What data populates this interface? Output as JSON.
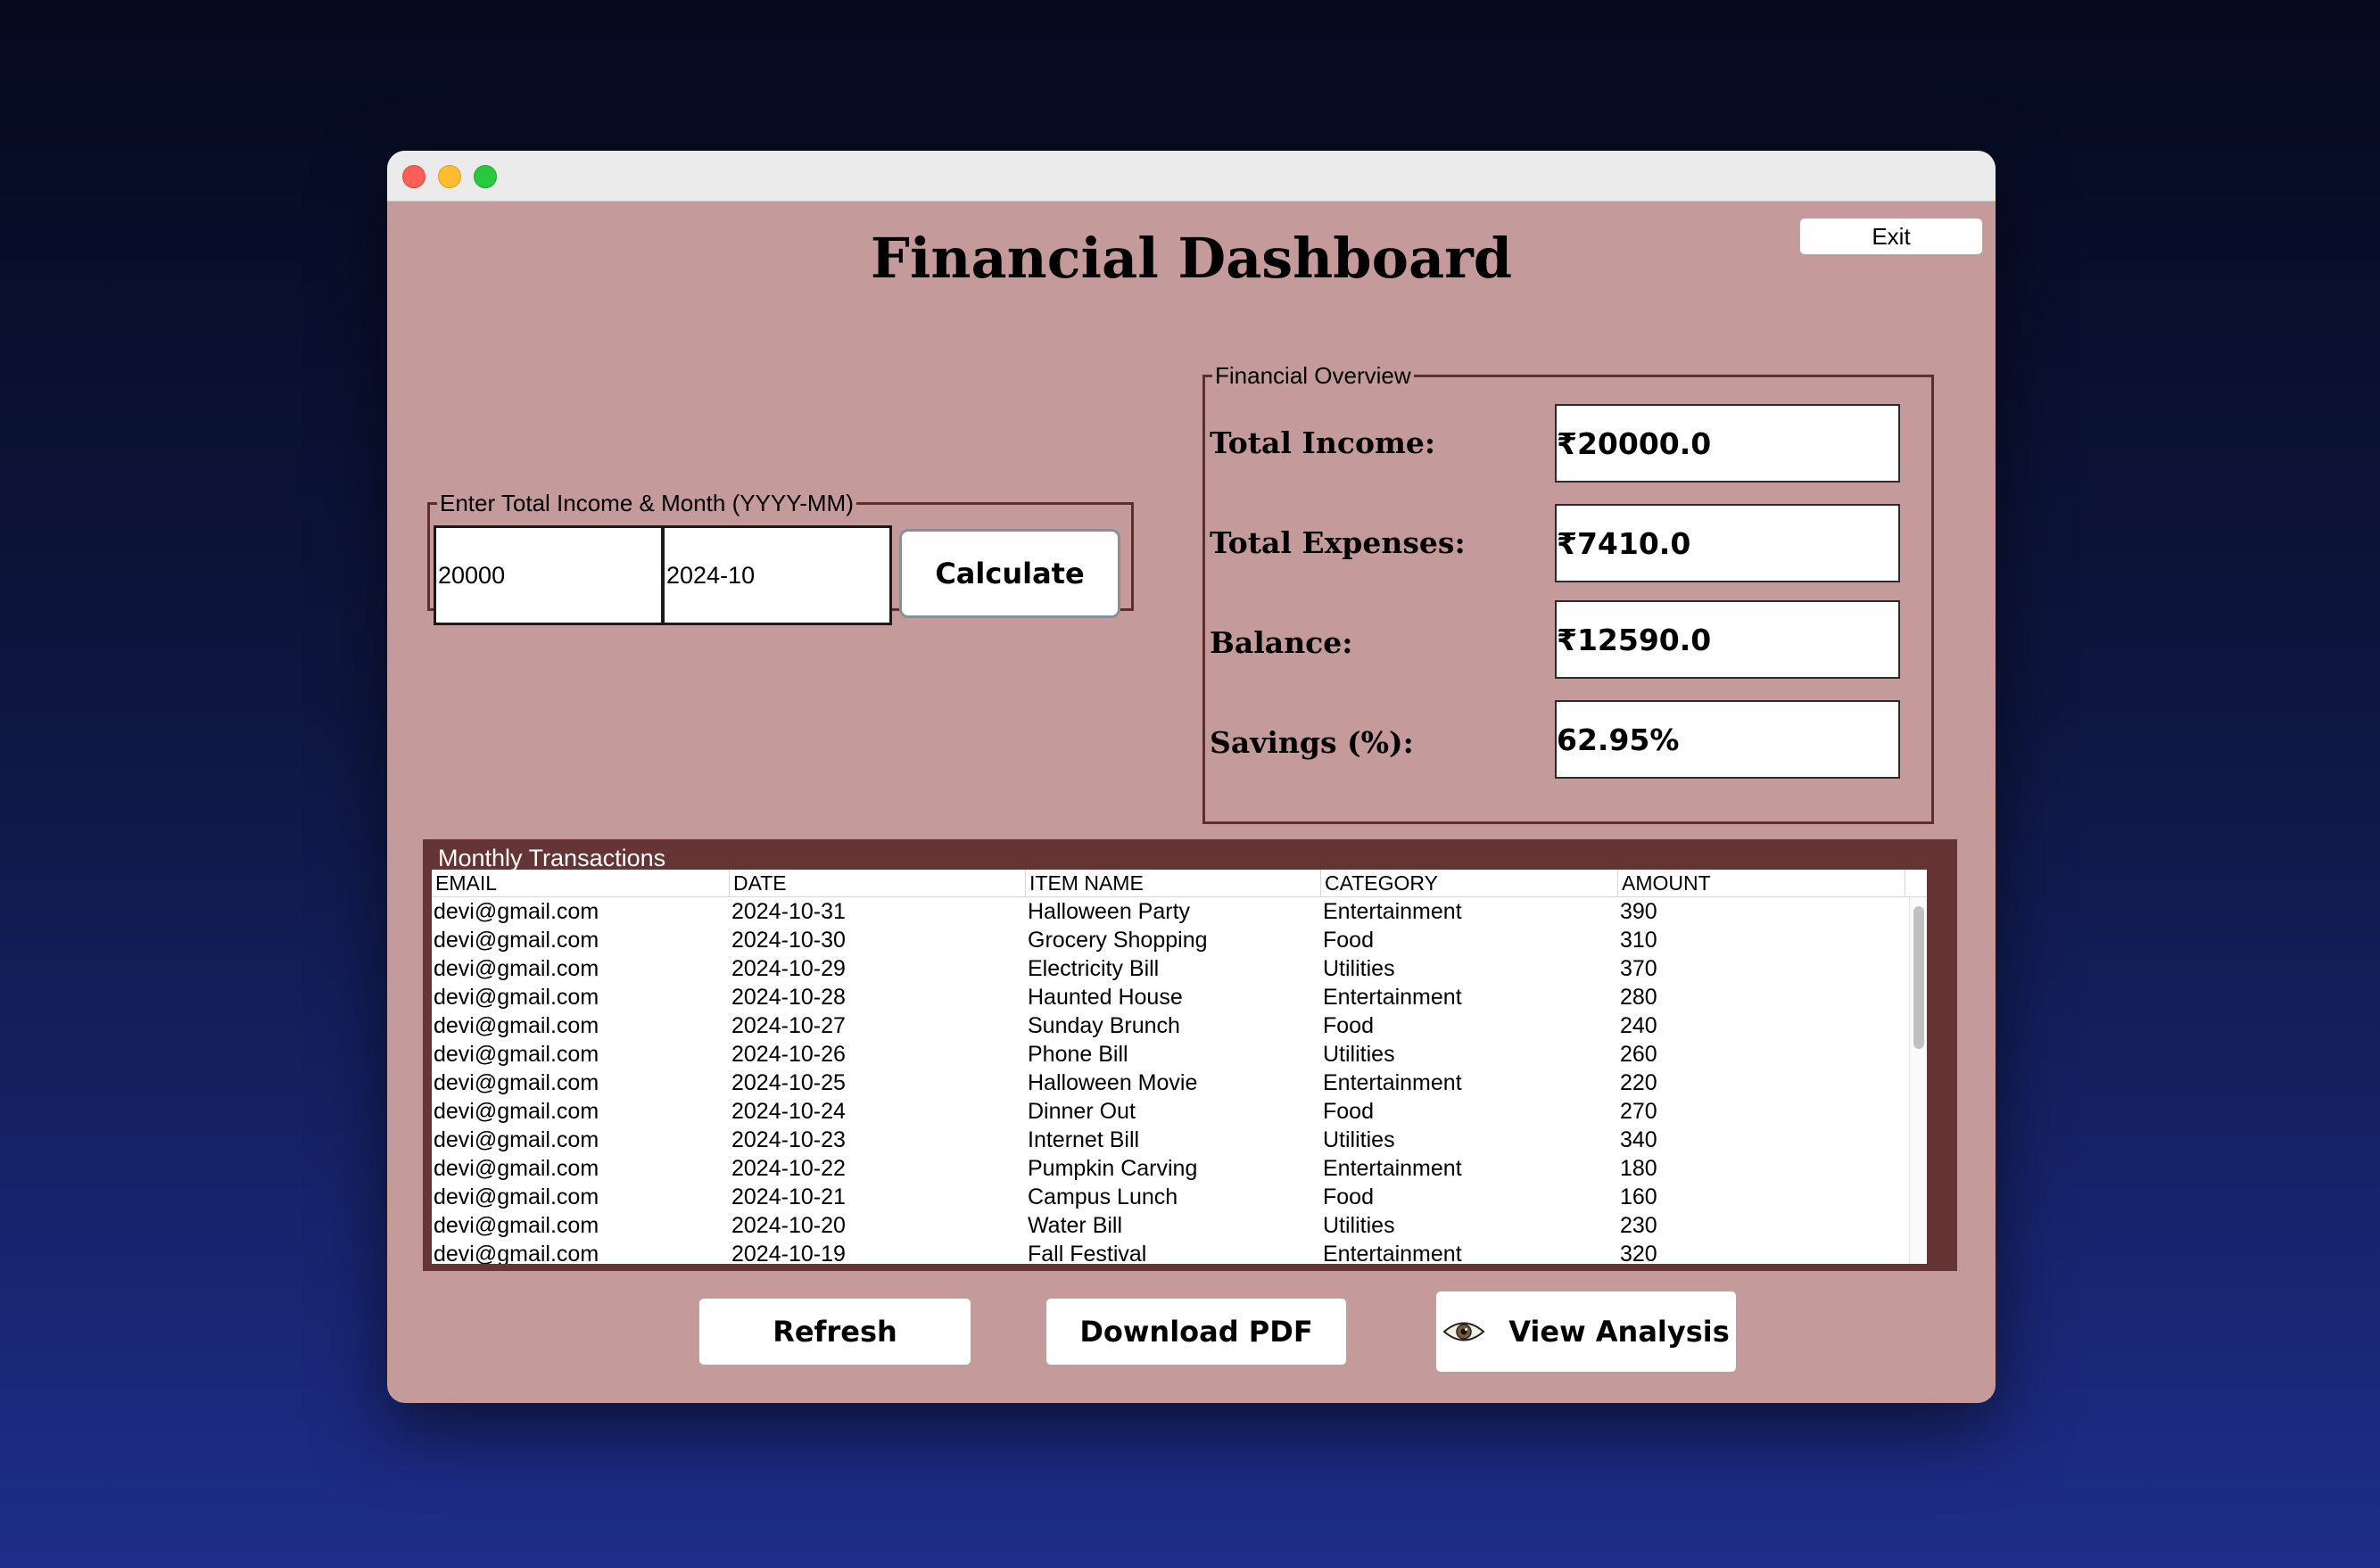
{
  "window": {
    "title": "Financial Dashboard",
    "exit_label": "Exit"
  },
  "income_form": {
    "legend": "Enter Total Income & Month (YYYY-MM)",
    "income_value": "20000",
    "month_value": "2024-10",
    "calculate_label": "Calculate"
  },
  "overview": {
    "legend": "Financial Overview",
    "total_income_label": "Total Income:",
    "total_income_value": "₹20000.0",
    "total_expenses_label": "Total Expenses:",
    "total_expenses_value": "₹7410.0",
    "balance_label": "Balance:",
    "balance_value": "₹12590.0",
    "savings_label": "Savings (%):",
    "savings_value": "62.95%"
  },
  "transactions": {
    "title": "Monthly Transactions",
    "columns": [
      "EMAIL",
      "DATE",
      "ITEM NAME",
      "CATEGORY",
      "AMOUNT"
    ],
    "rows": [
      [
        "devi@gmail.com",
        "2024-10-31",
        "Halloween Party",
        "Entertainment",
        "390"
      ],
      [
        "devi@gmail.com",
        "2024-10-30",
        "Grocery Shopping",
        "Food",
        "310"
      ],
      [
        "devi@gmail.com",
        "2024-10-29",
        "Electricity Bill",
        "Utilities",
        "370"
      ],
      [
        "devi@gmail.com",
        "2024-10-28",
        "Haunted House",
        "Entertainment",
        "280"
      ],
      [
        "devi@gmail.com",
        "2024-10-27",
        "Sunday Brunch",
        "Food",
        "240"
      ],
      [
        "devi@gmail.com",
        "2024-10-26",
        "Phone Bill",
        "Utilities",
        "260"
      ],
      [
        "devi@gmail.com",
        "2024-10-25",
        "Halloween Movie",
        "Entertainment",
        "220"
      ],
      [
        "devi@gmail.com",
        "2024-10-24",
        "Dinner Out",
        "Food",
        "270"
      ],
      [
        "devi@gmail.com",
        "2024-10-23",
        "Internet Bill",
        "Utilities",
        "340"
      ],
      [
        "devi@gmail.com",
        "2024-10-22",
        "Pumpkin Carving",
        "Entertainment",
        "180"
      ],
      [
        "devi@gmail.com",
        "2024-10-21",
        "Campus Lunch",
        "Food",
        "160"
      ],
      [
        "devi@gmail.com",
        "2024-10-20",
        "Water Bill",
        "Utilities",
        "230"
      ],
      [
        "devi@gmail.com",
        "2024-10-19",
        "Fall Festival",
        "Entertainment",
        "320"
      ]
    ]
  },
  "actions": {
    "refresh_label": "Refresh",
    "download_label": "Download PDF",
    "analysis_label": "View Analysis",
    "analysis_icon": "eye-icon"
  },
  "colors": {
    "window_bg": "#c49a9b",
    "panel_border": "#5e2e30",
    "table_header_bg": "#653535"
  }
}
